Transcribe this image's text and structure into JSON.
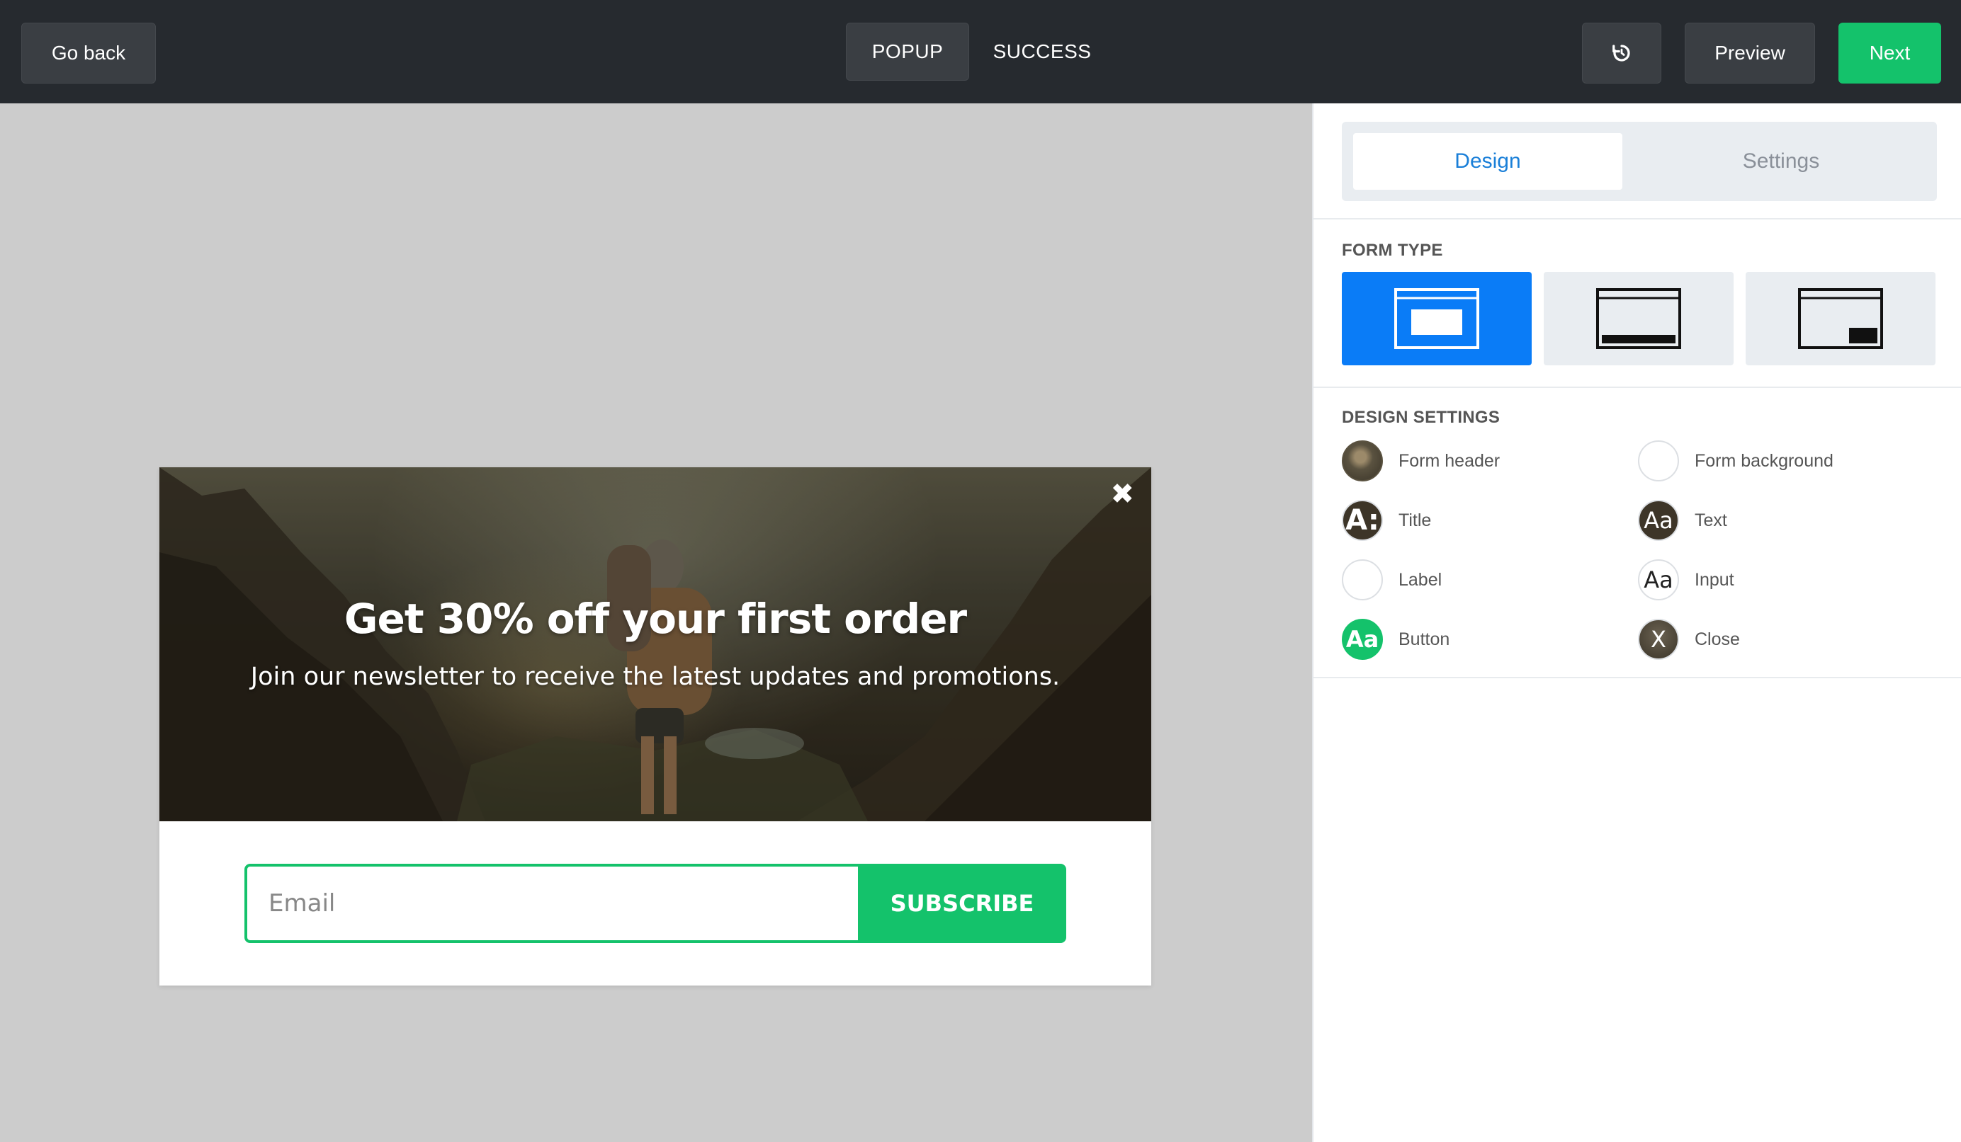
{
  "topbar": {
    "go_back": "Go back",
    "tabs": [
      {
        "label": "POPUP",
        "active": true
      },
      {
        "label": "SUCCESS",
        "active": false
      }
    ],
    "undo_icon": "undo-icon",
    "preview": "Preview",
    "next": "Next"
  },
  "popup": {
    "title": "Get 30% off your first order",
    "subtitle": "Join our newsletter to receive the latest updates and promotions.",
    "close_icon": "close-icon",
    "email_placeholder": "Email",
    "subscribe": "SUBSCRIBE"
  },
  "panel": {
    "tabs": [
      {
        "label": "Design",
        "active": true
      },
      {
        "label": "Settings",
        "active": false
      }
    ],
    "form_type_label": "FORM TYPE",
    "form_types": [
      {
        "icon": "popup-layout-icon",
        "active": true
      },
      {
        "icon": "bar-layout-icon",
        "active": false
      },
      {
        "icon": "corner-layout-icon",
        "active": false
      }
    ],
    "design_settings_label": "DESIGN SETTINGS",
    "settings": [
      {
        "label": "Form header",
        "swatch": "image"
      },
      {
        "label": "Form background",
        "swatch": "white"
      },
      {
        "label": "Title",
        "swatch": "A:"
      },
      {
        "label": "Text",
        "swatch": "Aa"
      },
      {
        "label": "Label",
        "swatch": "white"
      },
      {
        "label": "Input",
        "swatch": "Aa"
      },
      {
        "label": "Button",
        "swatch": "Aa"
      },
      {
        "label": "Close",
        "swatch": "X"
      }
    ]
  },
  "colors": {
    "accent_green": "#14c26b",
    "accent_blue": "#0a7cf7",
    "topbar": "#262a2f"
  }
}
